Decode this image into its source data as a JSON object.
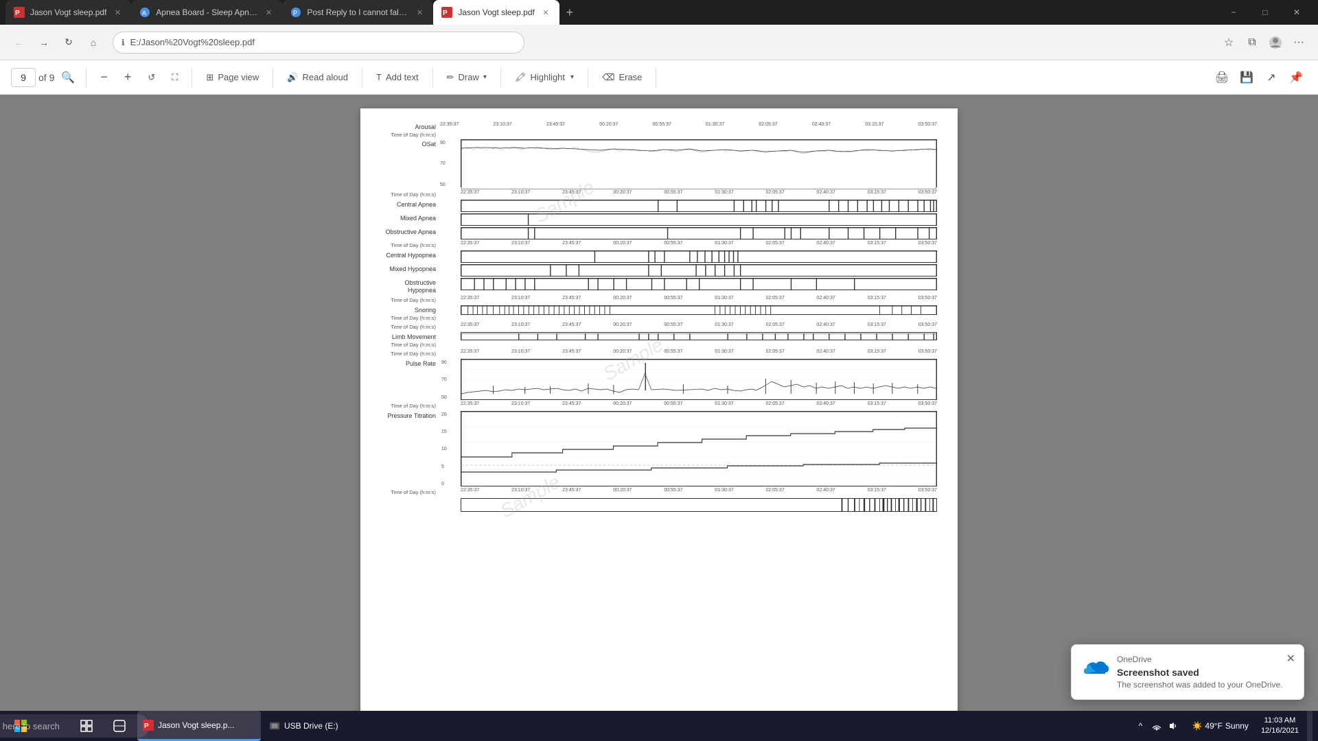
{
  "browser": {
    "tabs": [
      {
        "id": "tab1",
        "title": "Jason Vogt sleep.pdf",
        "favicon_color": "#d03030",
        "active": false
      },
      {
        "id": "tab2",
        "title": "Apnea Board - Sleep Apnea disc...",
        "favicon_color": "#4a90e2",
        "active": false
      },
      {
        "id": "tab3",
        "title": "Post Reply to I cannot fall aslee...",
        "favicon_color": "#4a90e2",
        "active": false
      },
      {
        "id": "tab4",
        "title": "Jason Vogt sleep.pdf",
        "favicon_color": "#d03030",
        "active": true
      }
    ],
    "address": "E:/Jason%20Vogt%20sleep.pdf",
    "address_protocol": "File"
  },
  "pdf_toolbar": {
    "page_current": "9",
    "page_total": "of 9",
    "zoom_out": "−",
    "zoom_in": "+",
    "fit_page": "",
    "page_view_label": "Page view",
    "read_aloud_label": "Read aloud",
    "add_text_label": "Add text",
    "draw_label": "Draw",
    "highlight_label": "Highlight",
    "erase_label": "Erase"
  },
  "time_labels": [
    "22:35:37",
    "23:10:37",
    "23:45:37",
    "00:20:37",
    "00:55:37",
    "01:30:37",
    "02:05:37",
    "02:40:37",
    "03:15:37",
    "03:50:37"
  ],
  "charts": {
    "arousal": {
      "label": "Arousal",
      "sublabel": "Time of Day (h:m:s)"
    },
    "osat": {
      "label": "OSat",
      "y_values": [
        "90",
        "70",
        "50"
      ]
    },
    "central_apnea": {
      "label": "Central Apnea"
    },
    "mixed_apnea": {
      "label": "Mixed Apnea"
    },
    "obstructive_apnea": {
      "label": "Obstructive Apnea"
    },
    "central_hypopnea": {
      "label": "Central Hypopnea"
    },
    "mixed_hypopnea": {
      "label": "Mixed Hypopnea"
    },
    "obstructive_hypopnea": {
      "label": "Obstructive Hypopnea"
    },
    "snoring": {
      "label": "Snoring"
    },
    "limb_movement": {
      "label": "Limb Movement"
    },
    "pulse_rate": {
      "label": "Pulse Rate",
      "y_values": [
        "90",
        "70",
        "50"
      ]
    },
    "pressure_titration": {
      "label": "Pressure Titration",
      "y_values": [
        "20",
        "15",
        "10",
        "5",
        "0"
      ]
    }
  },
  "taskbar": {
    "search_placeholder": "Type here to search",
    "apps": [
      {
        "label": "Jason Vogt sleep.p...",
        "active": true
      },
      {
        "label": "USB Drive (E:)",
        "active": false
      }
    ],
    "weather": {
      "temp": "49°F",
      "condition": "Sunny"
    },
    "time": "11:03 AM",
    "date": "12/16/2021"
  },
  "onedrive": {
    "app_name": "OneDrive",
    "title": "Screenshot saved",
    "message": "The screenshot was added to your OneDrive."
  }
}
